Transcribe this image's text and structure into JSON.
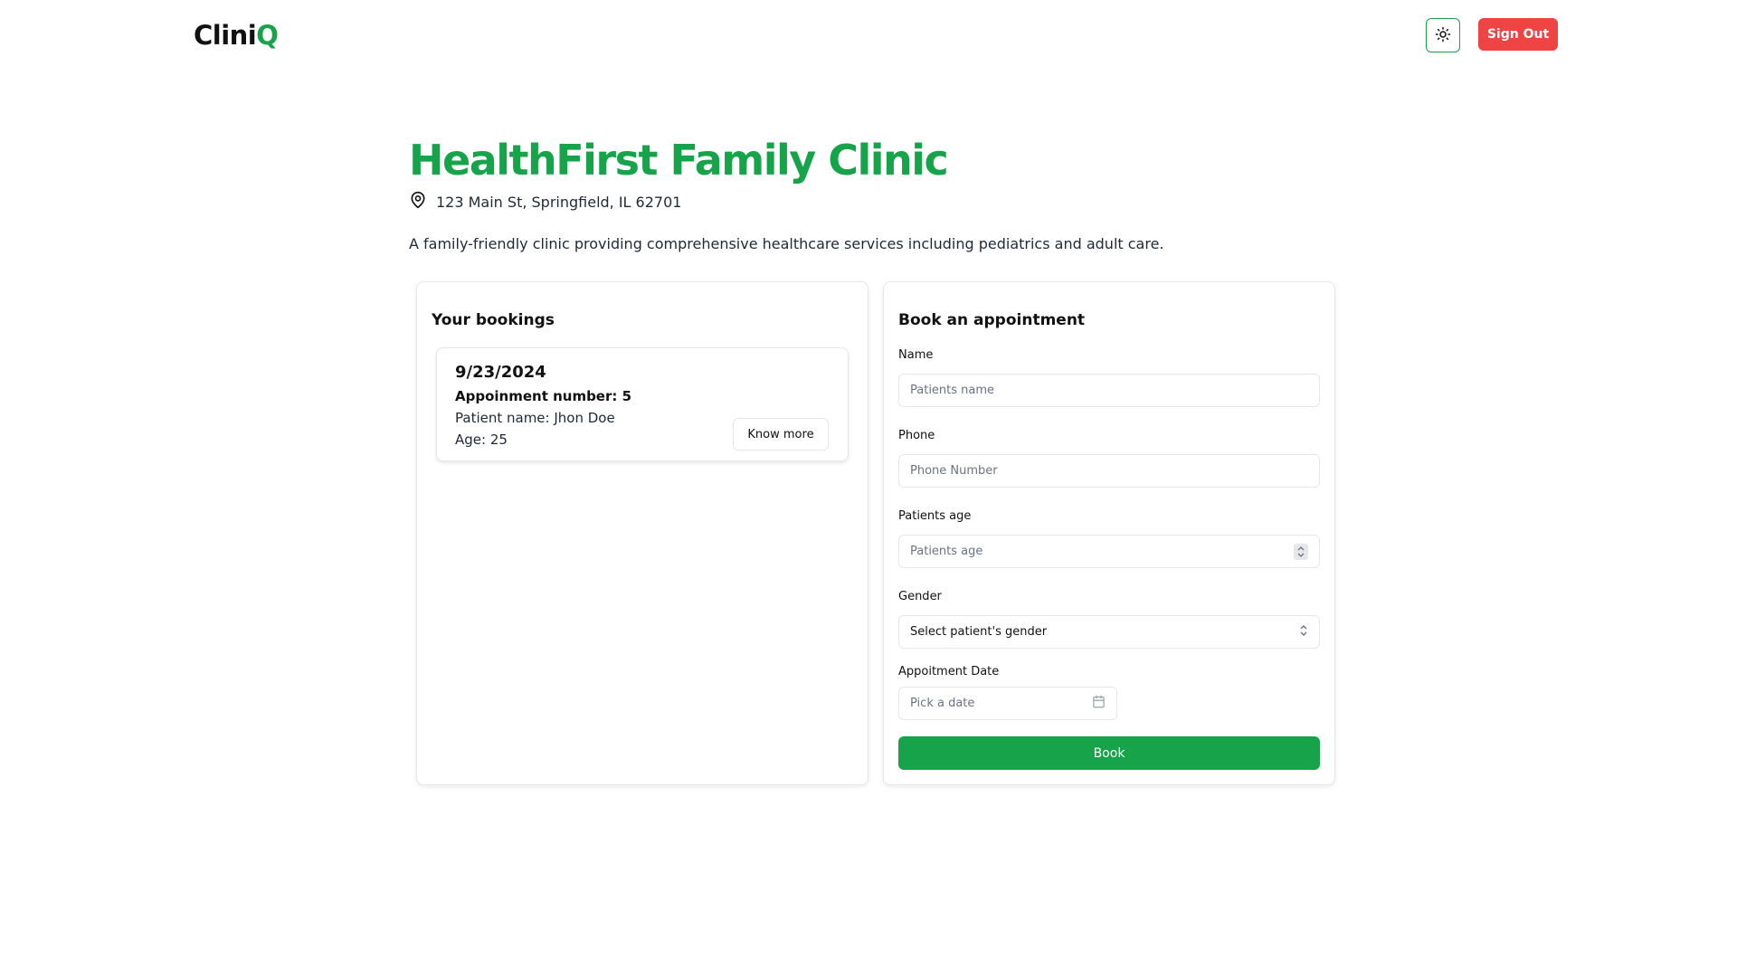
{
  "header": {
    "logo_main": "Clini",
    "logo_accent": "Q",
    "theme_icon": "sun-icon",
    "signout_label": "Sign Out"
  },
  "clinic": {
    "name": "HealthFirst Family Clinic",
    "address": "123 Main St, Springfield, IL 62701",
    "address_icon": "map-pin-icon",
    "description": "A family-friendly clinic providing comprehensive healthcare services including pediatrics and adult care."
  },
  "bookings": {
    "heading": "Your bookings",
    "items": [
      {
        "date": "9/23/2024",
        "appointment_number": "Appoinment number: 5",
        "patient": "Patient name: Jhon Doe",
        "age": "Age: 25",
        "action_label": "Know more"
      }
    ]
  },
  "form": {
    "heading": "Book an appointment",
    "name_label": "Name",
    "name_placeholder": "Patients name",
    "phone_label": "Phone",
    "phone_placeholder": "Phone Number",
    "age_label": "Patients age",
    "age_placeholder": "Patients age",
    "gender_label": "Gender",
    "gender_value": "Select patient's gender",
    "date_label": "Appoitment Date",
    "date_placeholder": "Pick a date",
    "calendar_icon": "calendar-icon",
    "submit_label": "Book"
  },
  "colors": {
    "accent": "#16a34a",
    "danger": "#ef4444"
  }
}
